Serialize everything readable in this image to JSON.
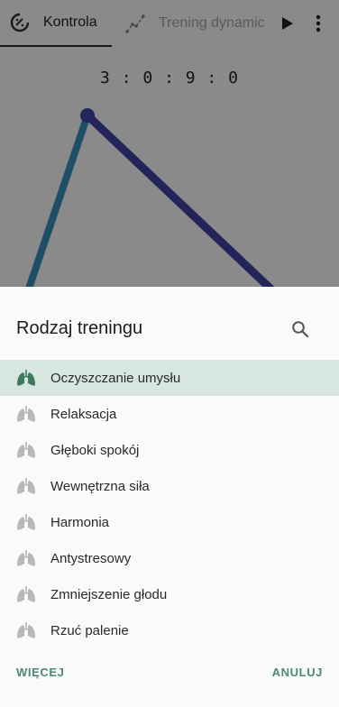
{
  "tabs": [
    {
      "label": "Kontrola",
      "icon": "timer-icon",
      "active": true
    },
    {
      "label": "Trening dynamic",
      "icon": "chart-line-icon",
      "active": false
    }
  ],
  "toolbar": {
    "play_icon": "play-icon",
    "more_icon": "more-vert-icon"
  },
  "timer": {
    "text": "3 : 0 : 9 : 0"
  },
  "sheet": {
    "title": "Rodzaj treningu",
    "search_icon": "search-icon",
    "items": [
      {
        "label": "Oczyszczanie umysłu",
        "icon": "lungs-icon",
        "selected": true
      },
      {
        "label": "Relaksacja",
        "icon": "lungs-icon",
        "selected": false
      },
      {
        "label": "Głęboki spokój",
        "icon": "lungs-icon",
        "selected": false
      },
      {
        "label": "Wewnętrzna siła",
        "icon": "lungs-icon",
        "selected": false
      },
      {
        "label": "Harmonia",
        "icon": "lungs-icon",
        "selected": false
      },
      {
        "label": "Antystresowy",
        "icon": "lungs-icon",
        "selected": false
      },
      {
        "label": "Zmniejszenie głodu",
        "icon": "lungs-icon",
        "selected": false
      },
      {
        "label": "Rzuć palenie",
        "icon": "lungs-icon",
        "selected": false
      }
    ],
    "more_label": "WIĘCEJ",
    "cancel_label": "ANULUJ"
  },
  "colors": {
    "accent": "#4a8a72",
    "selected_row": "#d8e6e0",
    "scrim": "#8a8a8a",
    "inhale_line": "#1e4f66",
    "exhale_line": "#22245a"
  }
}
